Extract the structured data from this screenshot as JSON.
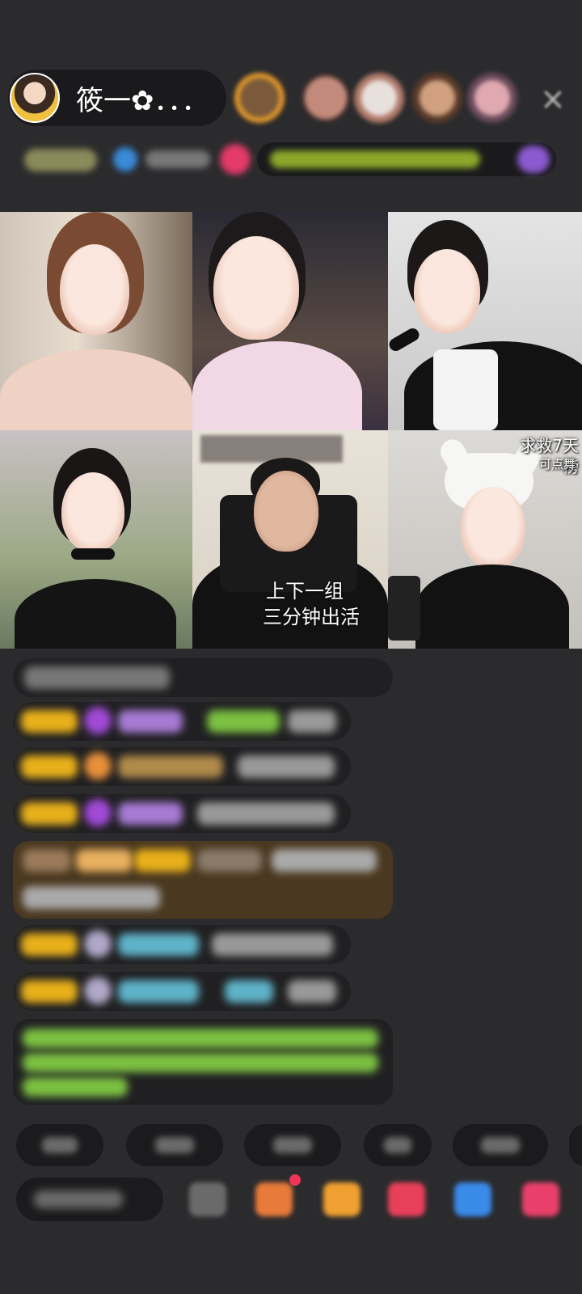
{
  "header": {
    "host_name": "筱一✿．．．",
    "close_label": "×"
  },
  "video_grid": {
    "cells": [
      {
        "id": "slot-1"
      },
      {
        "id": "slot-2"
      },
      {
        "id": "slot-3"
      },
      {
        "id": "slot-4"
      },
      {
        "id": "slot-5",
        "caption_line1": "上下一组",
        "caption_line2": "三分钟出活"
      },
      {
        "id": "slot-6",
        "rank_text": "求救7天榜",
        "sub_text": "可点舞"
      }
    ]
  },
  "colors": {
    "background": "#2b2b2d",
    "badge_gold": "#e8b01a",
    "name_purple": "#a77bd4",
    "name_cyan": "#5fb3c9",
    "highlight_green": "#7cc142"
  }
}
